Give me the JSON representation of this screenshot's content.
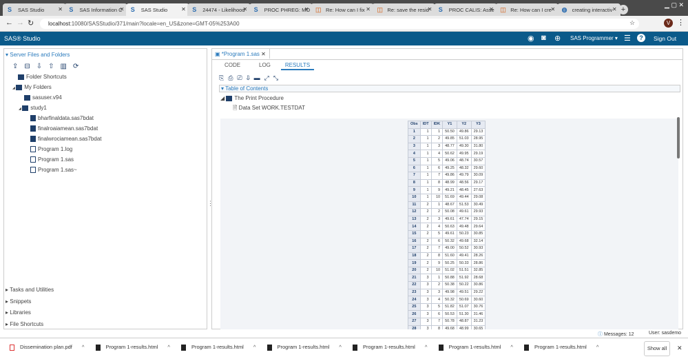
{
  "browser": {
    "tabs": [
      {
        "title": "SAS Studio",
        "icon": "sas-icon"
      },
      {
        "title": "SAS Information C",
        "icon": "sas-icon"
      },
      {
        "title": "SAS Studio",
        "icon": "sas-icon",
        "active": true
      },
      {
        "title": "24474 - Likelihood",
        "icon": "sas-icon"
      },
      {
        "title": "PROC PHREG: MO",
        "icon": "sas-icon"
      },
      {
        "title": "Re: How can I fix",
        "icon": "chat-icon"
      },
      {
        "title": "Re: save the resid",
        "icon": "chat-icon"
      },
      {
        "title": "PROC CALIS: Asse",
        "icon": "sas-icon"
      },
      {
        "title": "Re: How can I cre",
        "icon": "chat-icon"
      },
      {
        "title": "creating interactiv",
        "icon": "globe-icon"
      }
    ],
    "url_host": "localhost",
    "url_rest": ":10080/SASStudio/371/main?locale=en_US&zone=GMT-05%253A00",
    "profile_initial": "V"
  },
  "header": {
    "logo": "SAS® Studio",
    "role": "SAS Programmer ▾",
    "sign_out": "Sign Out"
  },
  "left": {
    "section": "Server Files and Folders",
    "tree": [
      {
        "label": "Folder Shortcuts",
        "level": 0
      },
      {
        "label": "My Folders",
        "level": 0,
        "expanded": true
      },
      {
        "label": "sasuser.v94",
        "level": 1
      },
      {
        "label": "study1",
        "level": 1,
        "expanded": true
      },
      {
        "label": "bharfinaldata.sas7bdat",
        "level": 2
      },
      {
        "label": "finalroaiamean.sas7bdat",
        "level": 2
      },
      {
        "label": "finalwrociamean.sas7bdat",
        "level": 2
      },
      {
        "label": "Program 1.log",
        "level": 2
      },
      {
        "label": "Program 1.sas",
        "level": 2
      },
      {
        "label": "Program 1.sas~",
        "level": 2
      }
    ],
    "bottom_sections": [
      "Tasks and Utilities",
      "Snippets",
      "Libraries",
      "File Shortcuts"
    ]
  },
  "editor": {
    "tab": "*Program 1.sas",
    "subtabs": [
      "CODE",
      "LOG",
      "RESULTS"
    ],
    "active_subtab": "RESULTS",
    "toc": {
      "title": "Table of Contents",
      "procedure": "The Print Procedure",
      "dataset": "Data Set WORK.TESTDAT"
    }
  },
  "table": {
    "columns": [
      "Obs",
      "IDT",
      "IDK",
      "Y1",
      "Y2",
      "Y3"
    ],
    "rows": [
      [
        "1",
        "1",
        "1",
        "50.50",
        "49.86",
        "29.13"
      ],
      [
        "2",
        "1",
        "2",
        "49.85",
        "51.03",
        "28.95"
      ],
      [
        "3",
        "1",
        "3",
        "48.77",
        "49.30",
        "31.80"
      ],
      [
        "4",
        "1",
        "4",
        "50.62",
        "49.95",
        "29.19"
      ],
      [
        "5",
        "1",
        "5",
        "49.06",
        "48.74",
        "30.57"
      ],
      [
        "6",
        "1",
        "6",
        "49.25",
        "48.32",
        "29.60"
      ],
      [
        "7",
        "1",
        "7",
        "49.86",
        "49.79",
        "30.09"
      ],
      [
        "8",
        "1",
        "8",
        "48.99",
        "48.56",
        "29.17"
      ],
      [
        "9",
        "1",
        "9",
        "49.21",
        "48.45",
        "27.63"
      ],
      [
        "10",
        "1",
        "10",
        "51.69",
        "49.44",
        "29.08"
      ],
      [
        "11",
        "2",
        "1",
        "48.67",
        "51.53",
        "30.49"
      ],
      [
        "12",
        "2",
        "2",
        "50.08",
        "49.61",
        "29.93"
      ],
      [
        "13",
        "2",
        "3",
        "49.61",
        "47.74",
        "29.15"
      ],
      [
        "14",
        "2",
        "4",
        "50.63",
        "49.48",
        "29.64"
      ],
      [
        "15",
        "2",
        "5",
        "49.61",
        "50.23",
        "30.85"
      ],
      [
        "16",
        "2",
        "6",
        "50.32",
        "49.68",
        "32.14"
      ],
      [
        "17",
        "2",
        "7",
        "49.00",
        "50.52",
        "30.93"
      ],
      [
        "18",
        "2",
        "8",
        "51.60",
        "49.41",
        "28.26"
      ],
      [
        "19",
        "2",
        "9",
        "50.25",
        "50.33",
        "28.86"
      ],
      [
        "20",
        "2",
        "10",
        "51.02",
        "51.51",
        "32.85"
      ],
      [
        "21",
        "3",
        "1",
        "50.88",
        "51.92",
        "28.68"
      ],
      [
        "22",
        "3",
        "2",
        "50.38",
        "50.22",
        "30.86"
      ],
      [
        "23",
        "3",
        "3",
        "49.98",
        "49.51",
        "29.22"
      ],
      [
        "24",
        "3",
        "4",
        "50.32",
        "50.69",
        "30.60"
      ],
      [
        "25",
        "3",
        "5",
        "51.82",
        "51.07",
        "30.76"
      ],
      [
        "26",
        "3",
        "6",
        "50.53",
        "51.30",
        "31.46"
      ],
      [
        "27",
        "3",
        "7",
        "50.78",
        "48.87",
        "31.23"
      ],
      [
        "28",
        "3",
        "8",
        "49.68",
        "48.99",
        "30.65"
      ]
    ]
  },
  "status": {
    "messages": "Messages: 12",
    "user": "User: sasdemo"
  },
  "downloads": {
    "items": [
      "Dissemination plan.pdf",
      "Program 1-results.html",
      "Program 1-results.html",
      "Program 1-results.html",
      "Program 1-results.html",
      "Program 1-results.html",
      "Program 1-results.html"
    ],
    "show_all": "Show all"
  }
}
